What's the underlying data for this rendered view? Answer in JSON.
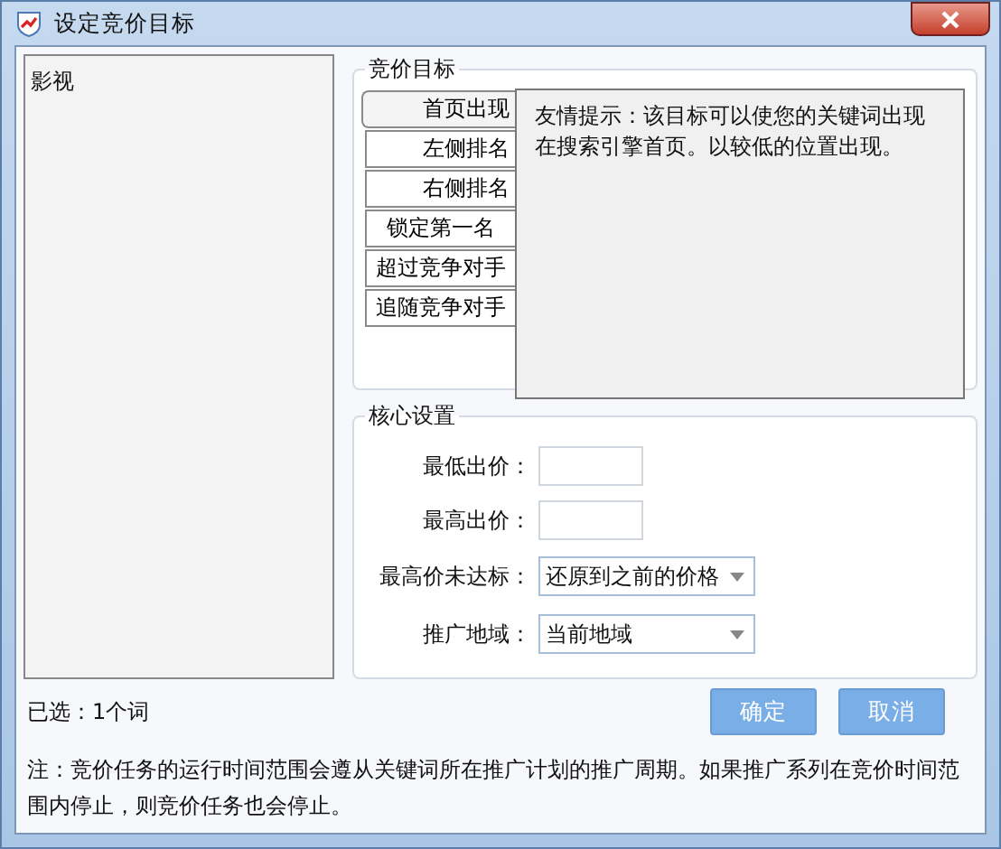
{
  "window": {
    "title": "设定竞价目标"
  },
  "keyword_list": {
    "items": [
      "影视"
    ]
  },
  "target_group": {
    "title": "竞价目标",
    "tabs": [
      {
        "label": "首页出现",
        "selected": true
      },
      {
        "label": "左侧排名",
        "selected": false
      },
      {
        "label": "右侧排名",
        "selected": false
      },
      {
        "label": "锁定第一名",
        "selected": false
      },
      {
        "label": "超过竞争对手",
        "selected": false
      },
      {
        "label": "追随竞争对手",
        "selected": false
      }
    ],
    "tip": "友情提示：该目标可以使您的关键词出现在搜索引擎首页。以较低的位置出现。"
  },
  "core_group": {
    "title": "核心设置",
    "fields": [
      {
        "kind": "input",
        "label": "最低出价："
      },
      {
        "kind": "input",
        "label": "最高出价："
      },
      {
        "kind": "select",
        "label": "最高价未达标：",
        "value": "还原到之前的价格"
      },
      {
        "kind": "select",
        "label": "推广地域：",
        "value": "当前地域"
      }
    ]
  },
  "selected_count": "已选：1个词",
  "buttons": [
    "确定",
    "取消"
  ],
  "note": "注：竞价任务的运行时间范围会遵从关键词所在推广计划的推广周期。如果推广系列在竞价时间范围内停止，则竞价任务也会停止。"
}
